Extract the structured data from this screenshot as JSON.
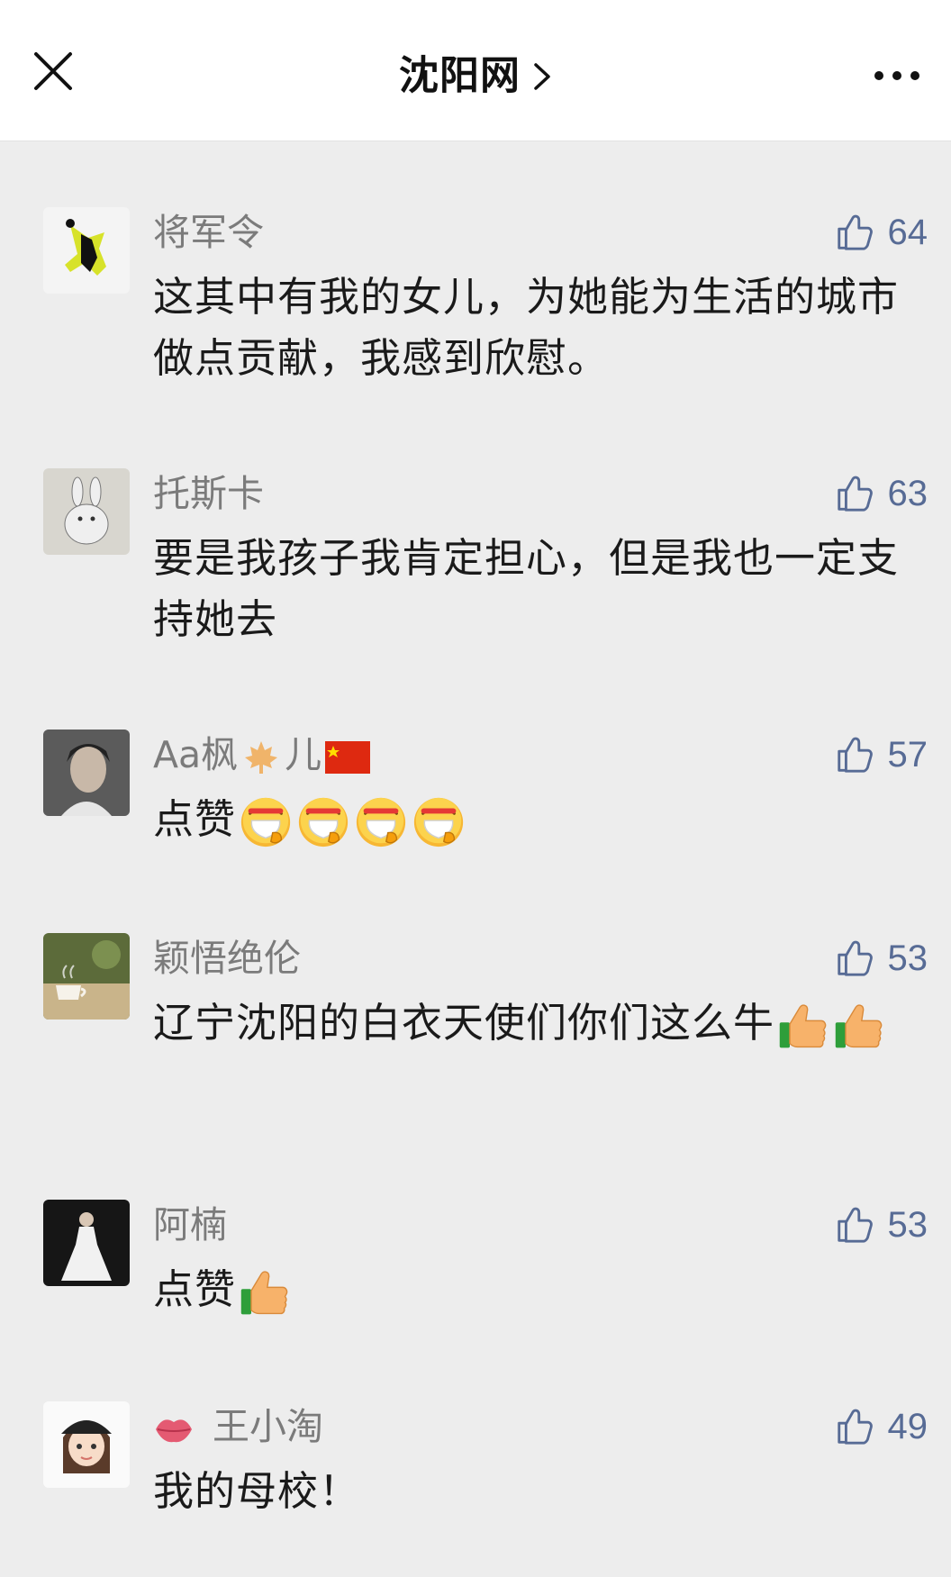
{
  "header": {
    "title": "沈阳网",
    "close_icon": "close-icon",
    "more_icon": "more-icon"
  },
  "colors": {
    "like_blue": "#576b95",
    "name_gray": "#7b7b7b",
    "background": "#ededed"
  },
  "comments": [
    {
      "username": "将军令",
      "likes": "64",
      "text": "这其中有我的女儿，为她能为生活的城市做点贡献，我感到欣慰。",
      "avatar": "dancer-avatar"
    },
    {
      "username": "托斯卡",
      "likes": "63",
      "text": "要是我孩子我肯定担心，但是我也一定支持她去",
      "avatar": "rabbit-sketch-avatar"
    },
    {
      "username": "Aa枫",
      "username_suffix": "儿",
      "likes": "57",
      "text": "点赞",
      "emojis": [
        "mask-face-emoji",
        "mask-face-emoji",
        "mask-face-emoji",
        "mask-face-emoji"
      ],
      "avatar": "portrait-avatar"
    },
    {
      "username": "颖悟绝伦",
      "likes": "53",
      "text": "辽宁沈阳的白衣天使们你们这么牛",
      "emojis": [
        "thumbs-up-emoji",
        "thumbs-up-emoji"
      ],
      "avatar": "coffee-cup-avatar"
    },
    {
      "username": "阿楠",
      "likes": "53",
      "text": "点赞",
      "emojis": [
        "thumbs-up-emoji"
      ],
      "avatar": "bride-avatar"
    },
    {
      "username": "王小淘",
      "likes": "49",
      "text": "我的母校！",
      "avatar": "cartoon-girl-avatar",
      "name_prefix_icon": "lips-icon"
    }
  ]
}
